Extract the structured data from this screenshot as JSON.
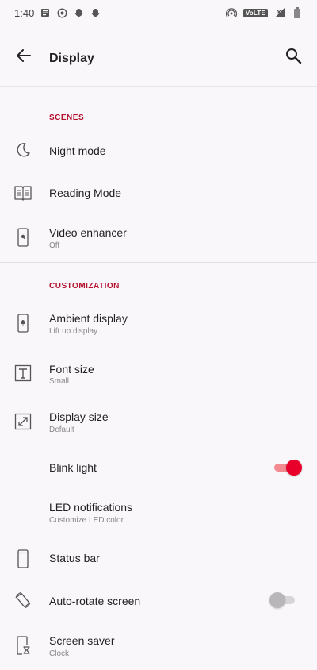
{
  "status_bar": {
    "time": "1:40",
    "network_label": "VoLTE",
    "left_icons": [
      "document-icon",
      "whatsapp-icon",
      "snapchat-icon",
      "snapchat-icon"
    ],
    "right_icons": [
      "hotspot-icon",
      "volte-icon",
      "signal-icon",
      "battery-icon"
    ]
  },
  "app_bar": {
    "title": "Display"
  },
  "sections": {
    "scenes": {
      "header": "SCENES"
    },
    "customization": {
      "header": "CUSTOMIZATION"
    }
  },
  "items": {
    "night_mode": {
      "title": "Night mode",
      "icon": "moon-icon"
    },
    "reading_mode": {
      "title": "Reading Mode",
      "icon": "book-icon"
    },
    "video_enhancer": {
      "title": "Video enhancer",
      "subtitle": "Off",
      "icon": "phone-video-icon"
    },
    "ambient_display": {
      "title": "Ambient display",
      "subtitle": "Lift up display",
      "icon": "phone-ambient-icon"
    },
    "font_size": {
      "title": "Font size",
      "subtitle": "Small",
      "icon": "text-size-icon"
    },
    "display_size": {
      "title": "Display size",
      "subtitle": "Default",
      "icon": "resize-icon"
    },
    "blink_light": {
      "title": "Blink light",
      "enabled": true
    },
    "led_notifications": {
      "title": "LED notifications",
      "subtitle": "Customize LED color"
    },
    "status_bar_item": {
      "title": "Status bar",
      "icon": "phone-outline-icon"
    },
    "auto_rotate": {
      "title": "Auto-rotate screen",
      "enabled": false,
      "icon": "rotate-icon"
    },
    "screen_saver": {
      "title": "Screen saver",
      "subtitle": "Clock",
      "icon": "hourglass-phone-icon"
    }
  },
  "colors": {
    "accent": "#b3122e",
    "toggle_on": "#e8002a",
    "background": "#faf7fa"
  }
}
